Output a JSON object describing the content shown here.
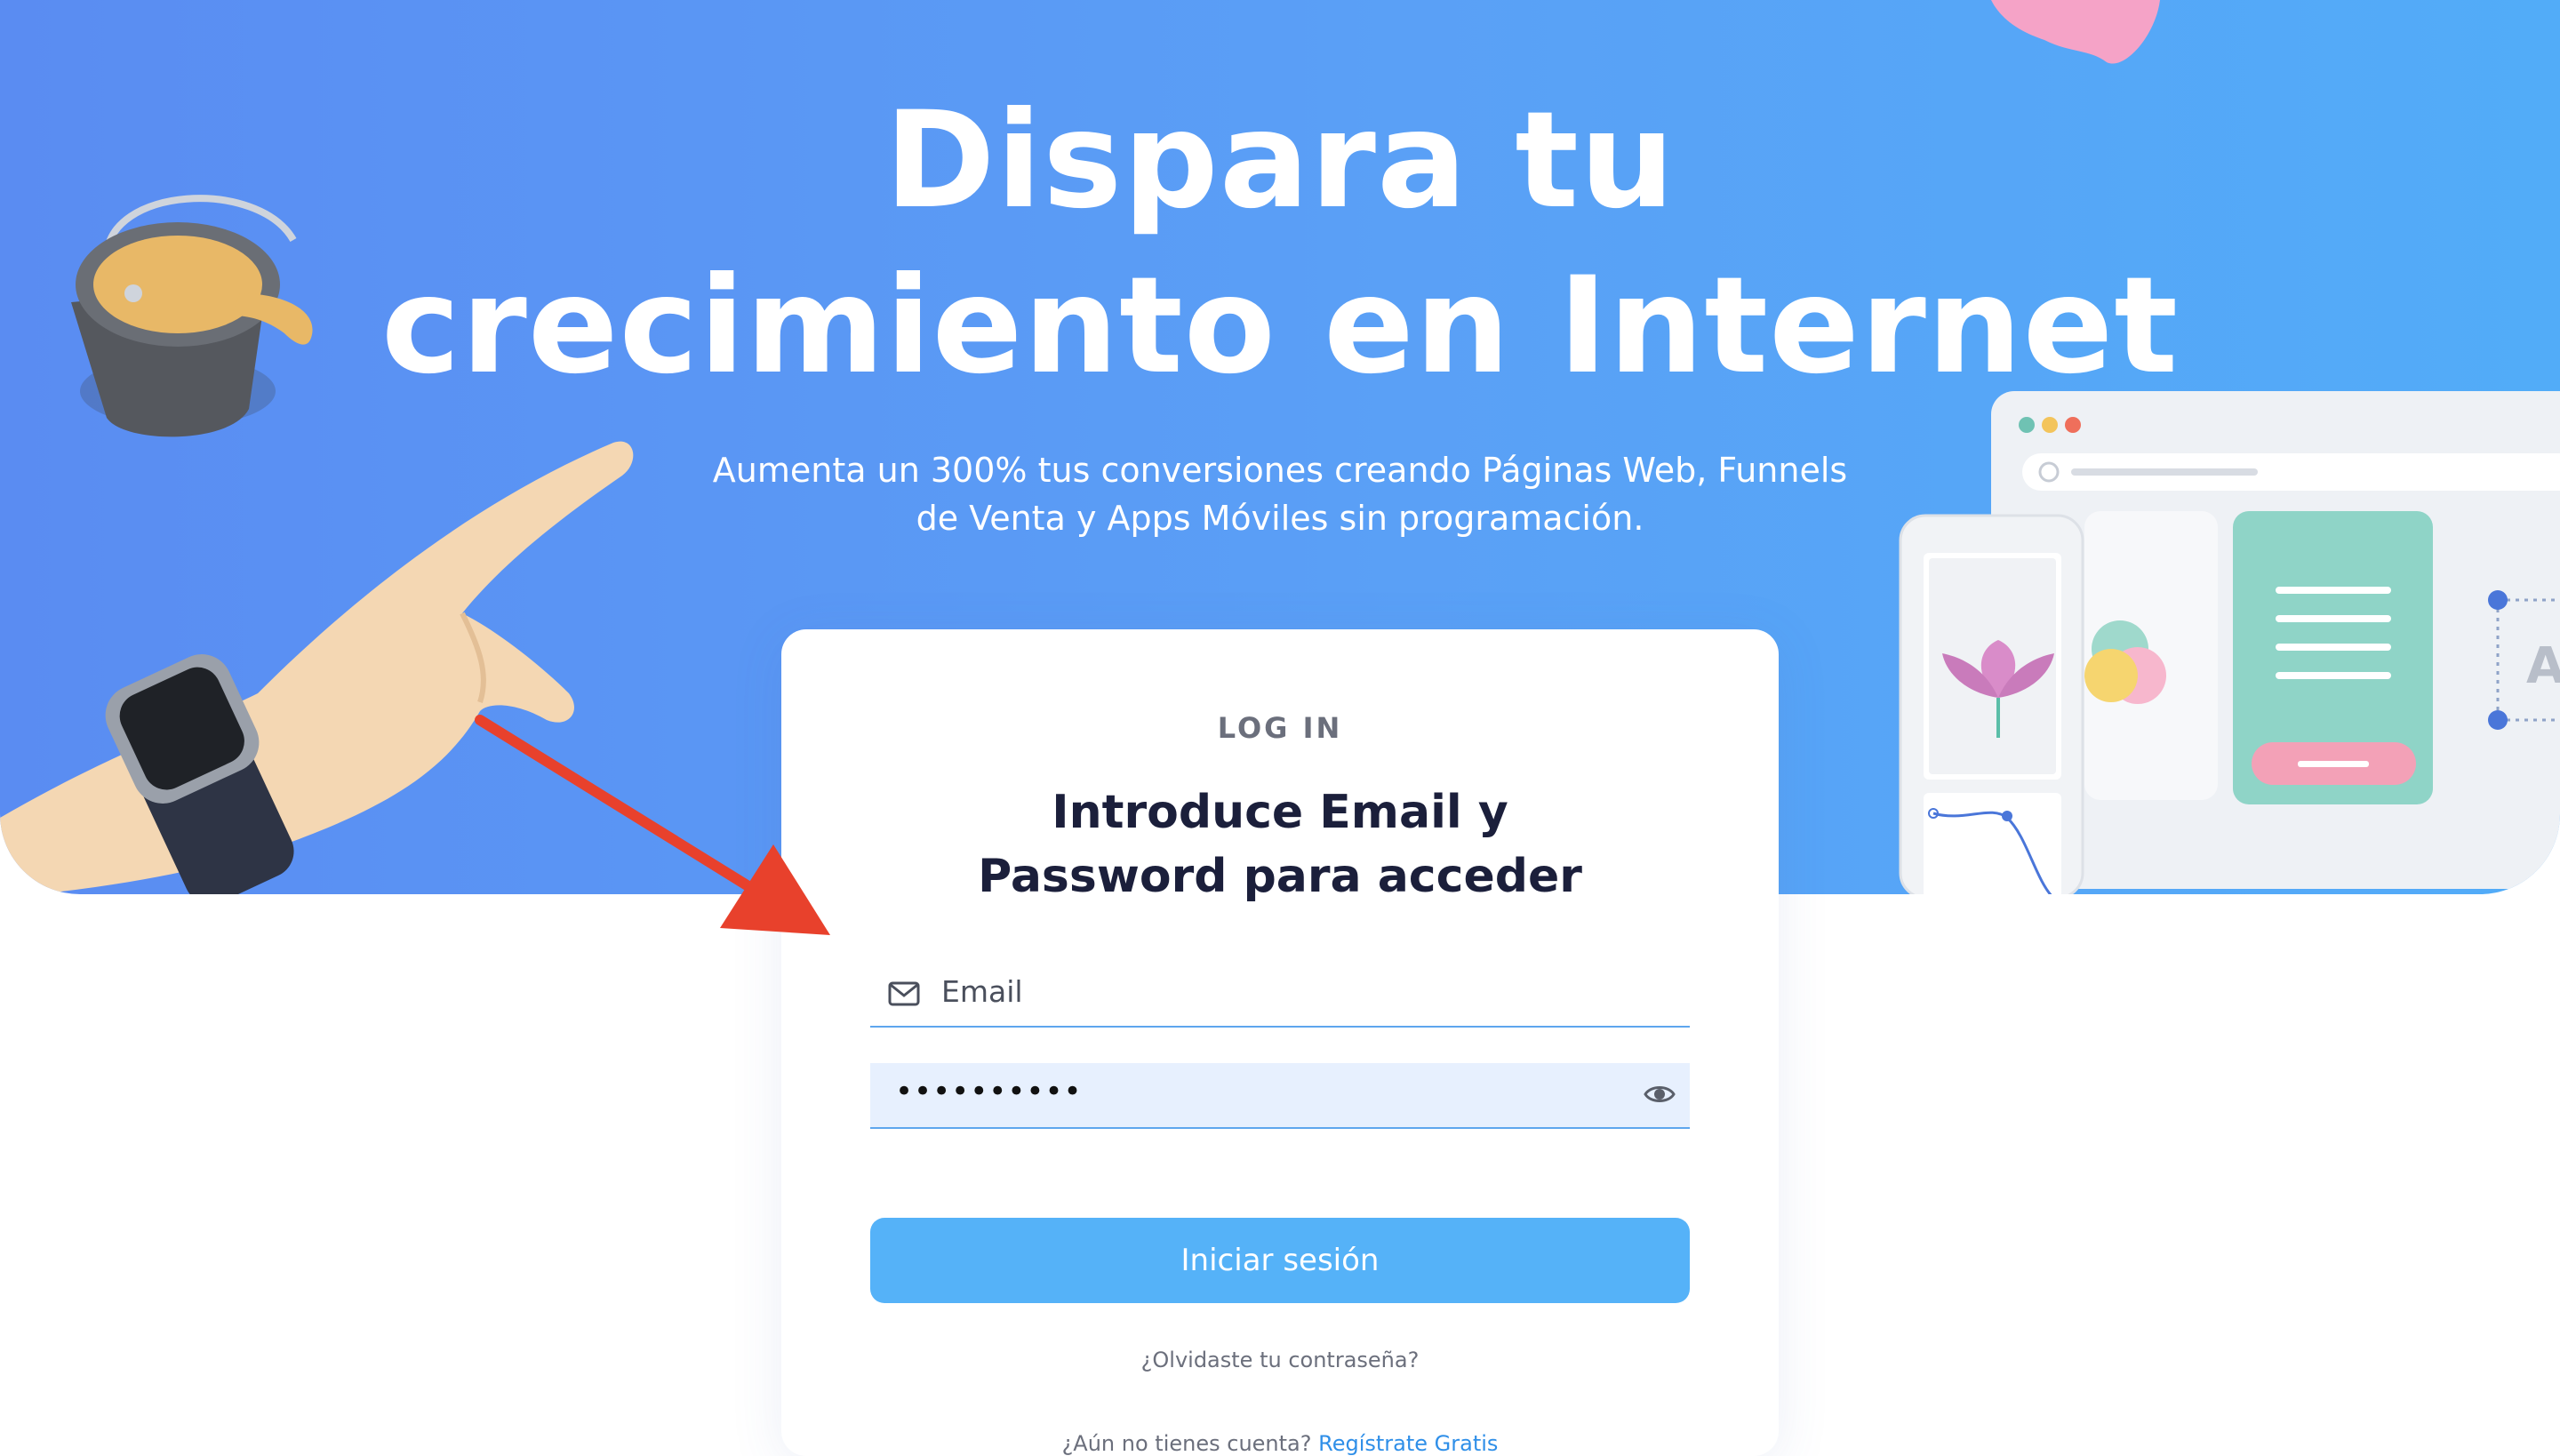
{
  "hero": {
    "title_line1": "Dispara tu",
    "title_line2": "crecimiento en Internet",
    "subtitle_line1": "Aumenta un 300% tus conversiones creando Páginas Web, Funnels",
    "subtitle_line2": "de Venta y Apps Móviles sin programación."
  },
  "login": {
    "kicker": "LOG IN",
    "heading_line1": "Introduce Email y",
    "heading_line2": "Password para acceder",
    "email_placeholder": "Email",
    "password_value": "••••••••••",
    "submit_label": "Iniciar sesión",
    "forgot_label": "¿Olvidaste tu contraseña?",
    "signup_prompt": "¿Aún no tienes cuenta? ",
    "signup_link": "Regístrate Gratis"
  },
  "mockup": {
    "side_letter": "A"
  },
  "icons": {
    "email": "envelope-icon",
    "password_toggle": "eye-icon"
  },
  "colors": {
    "hero_start": "#5a8cf2",
    "hero_end": "#52acf8",
    "button": "#55b2f8",
    "arrow": "#e8412c",
    "heading": "#1b1f3b",
    "link": "#2f8fe8"
  }
}
